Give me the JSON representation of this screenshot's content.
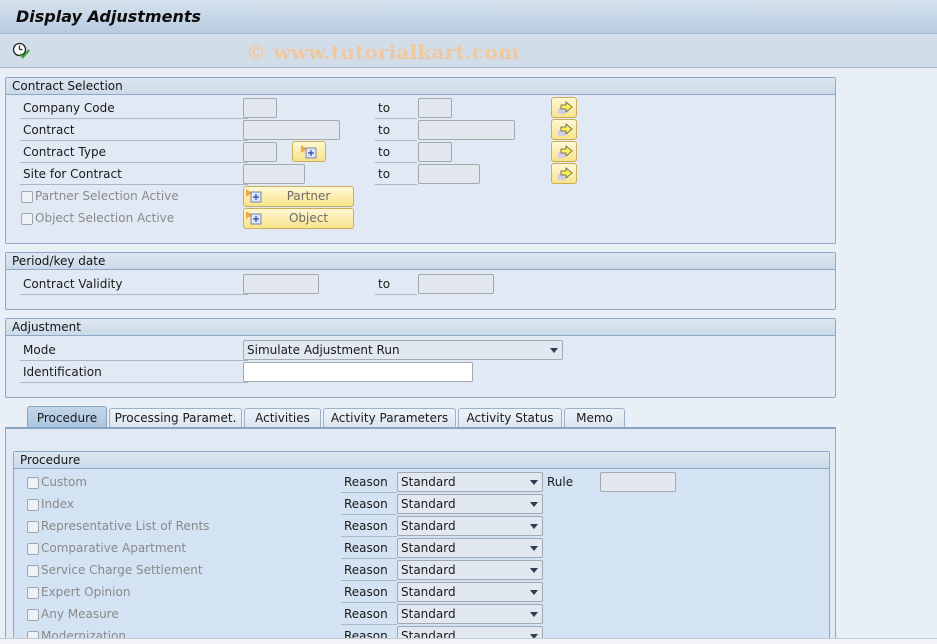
{
  "window": {
    "title": "Display Adjustments",
    "watermark": "© www.tutorialkart.com",
    "toolbar": {
      "execute_icon": "execute-clock-icon"
    }
  },
  "contract_selection": {
    "title": "Contract Selection",
    "rows": [
      {
        "label": "Company Code",
        "from": "",
        "to_label": "to",
        "to": ""
      },
      {
        "label": "Contract",
        "from": "",
        "to_label": "to",
        "to": ""
      },
      {
        "label": "Contract Type",
        "from": "",
        "to_label": "to",
        "to": ""
      },
      {
        "label": "Site for Contract",
        "from": "",
        "to_label": "to",
        "to": ""
      }
    ],
    "partner_selection": {
      "label": "Partner Selection Active",
      "checked": false,
      "button": "Partner"
    },
    "object_selection": {
      "label": "Object Selection Active",
      "checked": false,
      "button": "Object"
    }
  },
  "period": {
    "title": "Period/key date",
    "label": "Contract Validity",
    "from": "",
    "to_label": "to",
    "to": ""
  },
  "adjustment": {
    "title": "Adjustment",
    "mode_label": "Mode",
    "mode_value": "Simulate Adjustment Run",
    "identification_label": "Identification",
    "identification_value": ""
  },
  "tabs": [
    {
      "label": "Procedure",
      "active": true
    },
    {
      "label": "Processing Paramet.",
      "active": false
    },
    {
      "label": "Activities",
      "active": false
    },
    {
      "label": "Activity Parameters",
      "active": false
    },
    {
      "label": "Activity Status",
      "active": false
    },
    {
      "label": "Memo",
      "active": false
    }
  ],
  "procedure": {
    "title": "Procedure",
    "reason_label": "Reason",
    "rule_label": "Rule",
    "rule_value": "",
    "items": [
      {
        "label": "Custom",
        "checked": false,
        "reason": "Standard"
      },
      {
        "label": "Index",
        "checked": false,
        "reason": "Standard"
      },
      {
        "label": "Representative List of Rents",
        "checked": false,
        "reason": "Standard"
      },
      {
        "label": "Comparative Apartment",
        "checked": false,
        "reason": "Standard"
      },
      {
        "label": "Service Charge Settlement",
        "checked": false,
        "reason": "Standard"
      },
      {
        "label": "Expert Opinion",
        "checked": false,
        "reason": "Standard"
      },
      {
        "label": "Any Measure",
        "checked": false,
        "reason": "Standard"
      },
      {
        "label": "Modernization",
        "checked": false,
        "reason": "Standard"
      }
    ]
  }
}
